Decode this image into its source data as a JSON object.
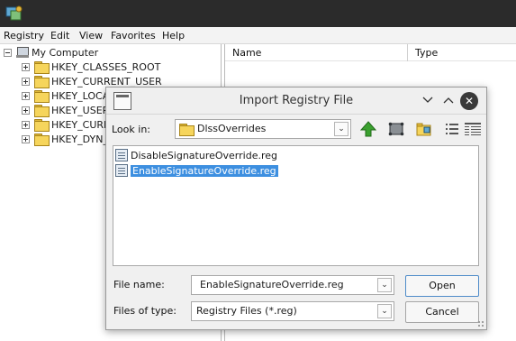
{
  "menubar": {
    "items": [
      {
        "label": "Registry"
      },
      {
        "label": "Edit"
      },
      {
        "label": "View"
      },
      {
        "label": "Favorites"
      },
      {
        "label": "Help"
      }
    ]
  },
  "tree": {
    "root": "My Computer",
    "items": [
      {
        "label": "HKEY_CLASSES_ROOT"
      },
      {
        "label": "HKEY_CURRENT_USER"
      },
      {
        "label": "HKEY_LOCAL_MACHINE"
      },
      {
        "label": "HKEY_USERS"
      },
      {
        "label": "HKEY_CURRENT_CONFIG"
      },
      {
        "label": "HKEY_DYN_DATA"
      }
    ]
  },
  "list": {
    "columns": [
      "Name",
      "Type"
    ]
  },
  "dialog": {
    "title": "Import Registry File",
    "look_in_label": "Look in:",
    "look_in_value": "DlssOverrides",
    "files": [
      {
        "name": "DisableSignatureOverride.reg",
        "selected": false
      },
      {
        "name": "EnableSignatureOverride.reg",
        "selected": true
      }
    ],
    "file_name_label": "File name:",
    "file_name_value": "EnableSignatureOverride.reg",
    "files_of_type_label": "Files of type:",
    "files_of_type_value": "Registry Files (*.reg)",
    "open_label": "Open",
    "cancel_label": "Cancel"
  },
  "colors": {
    "selection": "#3d8fe0",
    "titlebar": "#2b2b2b",
    "up_arrow": "#3aa02e"
  }
}
